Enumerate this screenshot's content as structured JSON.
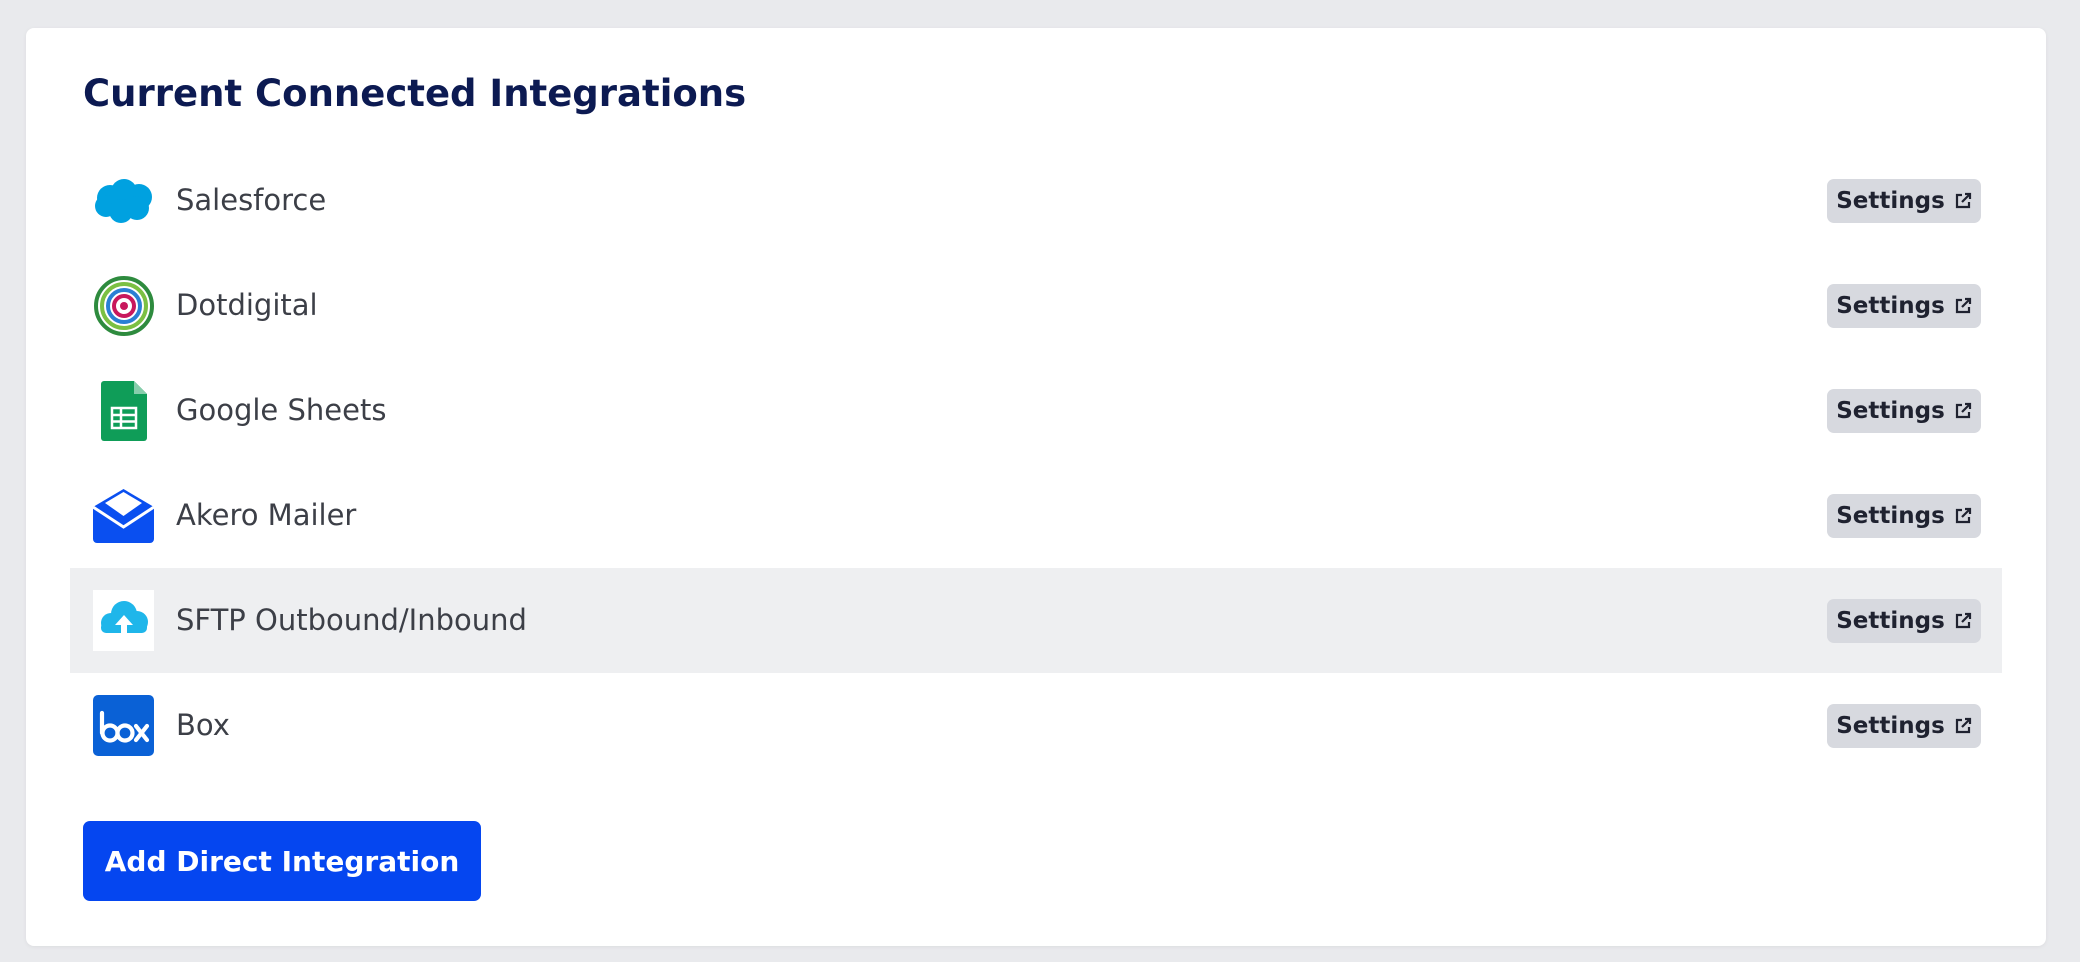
{
  "page": {
    "title": "Current Connected Integrations",
    "add_button_label": "Add Direct Integration"
  },
  "integrations": [
    {
      "name": "Salesforce",
      "icon": "salesforce-logo-icon",
      "settings_label": "Settings"
    },
    {
      "name": "Dotdigital",
      "icon": "dotdigital-logo-icon",
      "settings_label": "Settings"
    },
    {
      "name": "Google Sheets",
      "icon": "google-sheets-logo-icon",
      "settings_label": "Settings"
    },
    {
      "name": "Akero Mailer",
      "icon": "akero-mailer-logo-icon",
      "settings_label": "Settings"
    },
    {
      "name": "SFTP Outbound/Inbound",
      "icon": "sftp-cloud-upload-icon",
      "settings_label": "Settings",
      "hovered": true
    },
    {
      "name": "Box",
      "icon": "box-logo-icon",
      "settings_label": "Settings",
      "logo_text": "box"
    }
  ],
  "colors": {
    "title": "#0c1a52",
    "primary_button": "#0546f0",
    "settings_button_bg": "#d7d9df",
    "row_hover_bg": "#eeeff1",
    "salesforce": "#00a1e0",
    "google_sheets": "#0f9d58",
    "akero": "#0a4ff0",
    "sftp": "#1fb6ea",
    "box": "#0a61d6"
  }
}
